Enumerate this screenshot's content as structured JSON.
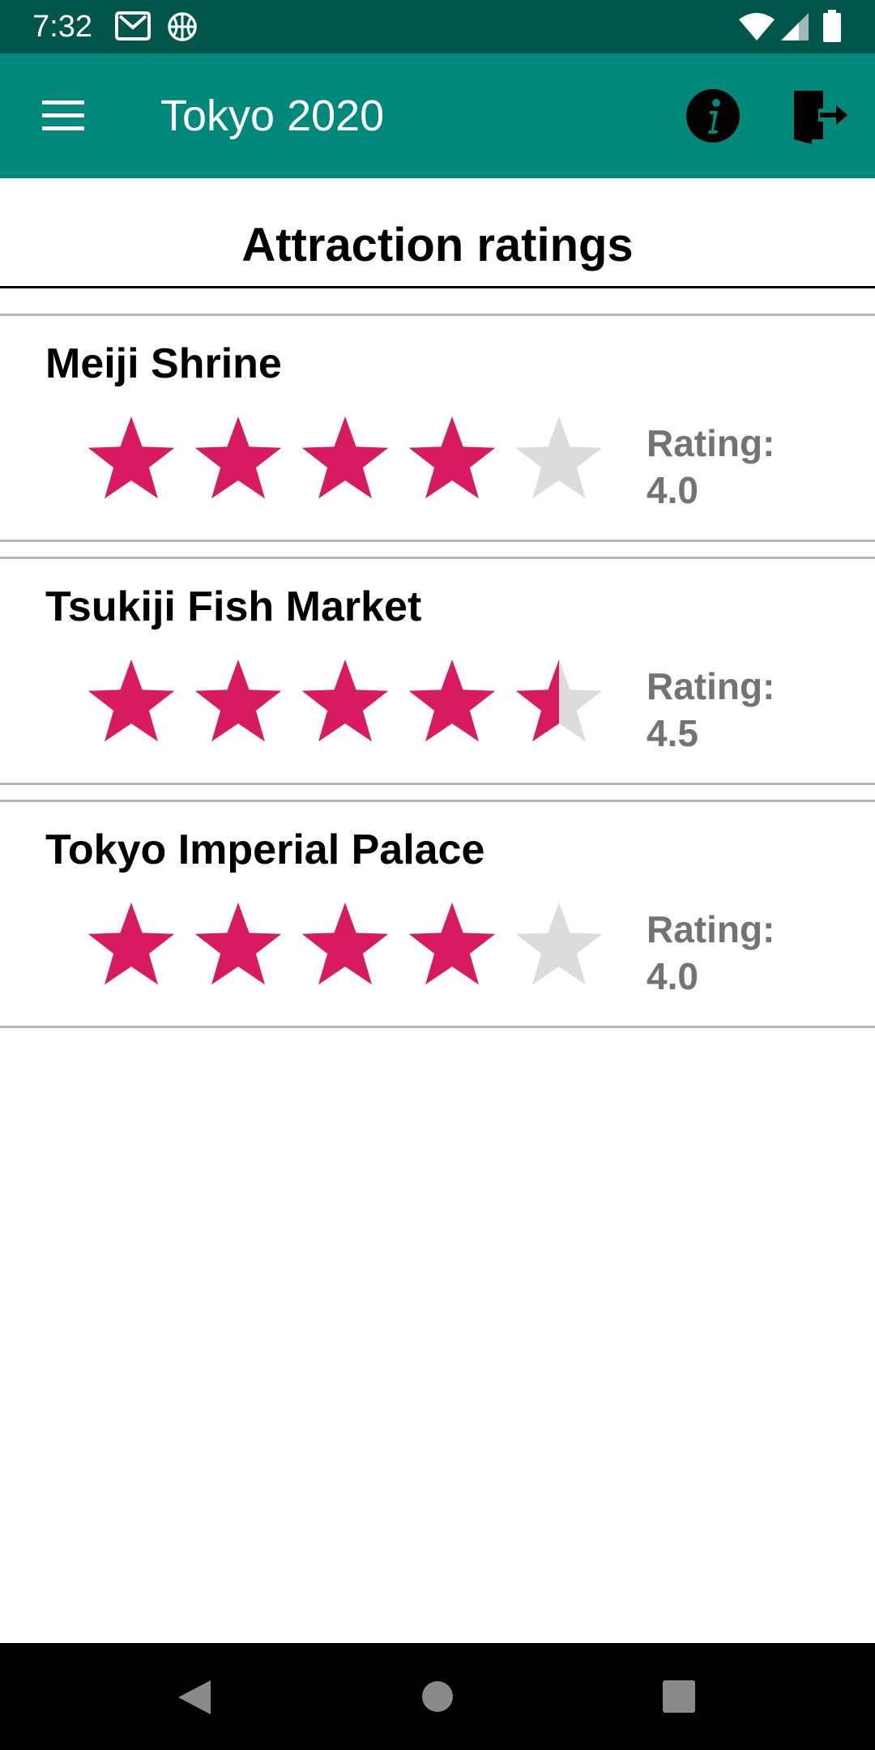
{
  "status_bar": {
    "time": "7:32",
    "icons": [
      "gmail-icon",
      "basketball-icon",
      "wifi-icon",
      "signal-icon",
      "battery-icon"
    ]
  },
  "app_bar": {
    "title": "Tokyo 2020",
    "menu_icon": "hamburger-menu-icon",
    "info_icon": "info-icon",
    "exit_icon": "exit-door-icon",
    "background": "#00897b"
  },
  "page": {
    "title": "Attraction ratings"
  },
  "attractions": [
    {
      "name": "Meiji Shrine",
      "rating_label": "Rating:",
      "rating_value": "4.0",
      "rating": 4.0,
      "max_stars": 5
    },
    {
      "name": "Tsukiji Fish Market",
      "rating_label": "Rating:",
      "rating_value": "4.5",
      "rating": 4.5,
      "max_stars": 5
    },
    {
      "name": "Tokyo Imperial Palace",
      "rating_label": "Rating:",
      "rating_value": "4.0",
      "rating": 4.0,
      "max_stars": 5
    }
  ],
  "colors": {
    "star_filled": "#d81b60",
    "star_empty": "#dcdcdc",
    "status_bar": "#00564b",
    "rating_text": "#737373"
  },
  "nav_bar": {
    "icons": [
      "back-icon",
      "home-icon",
      "recents-icon"
    ]
  }
}
